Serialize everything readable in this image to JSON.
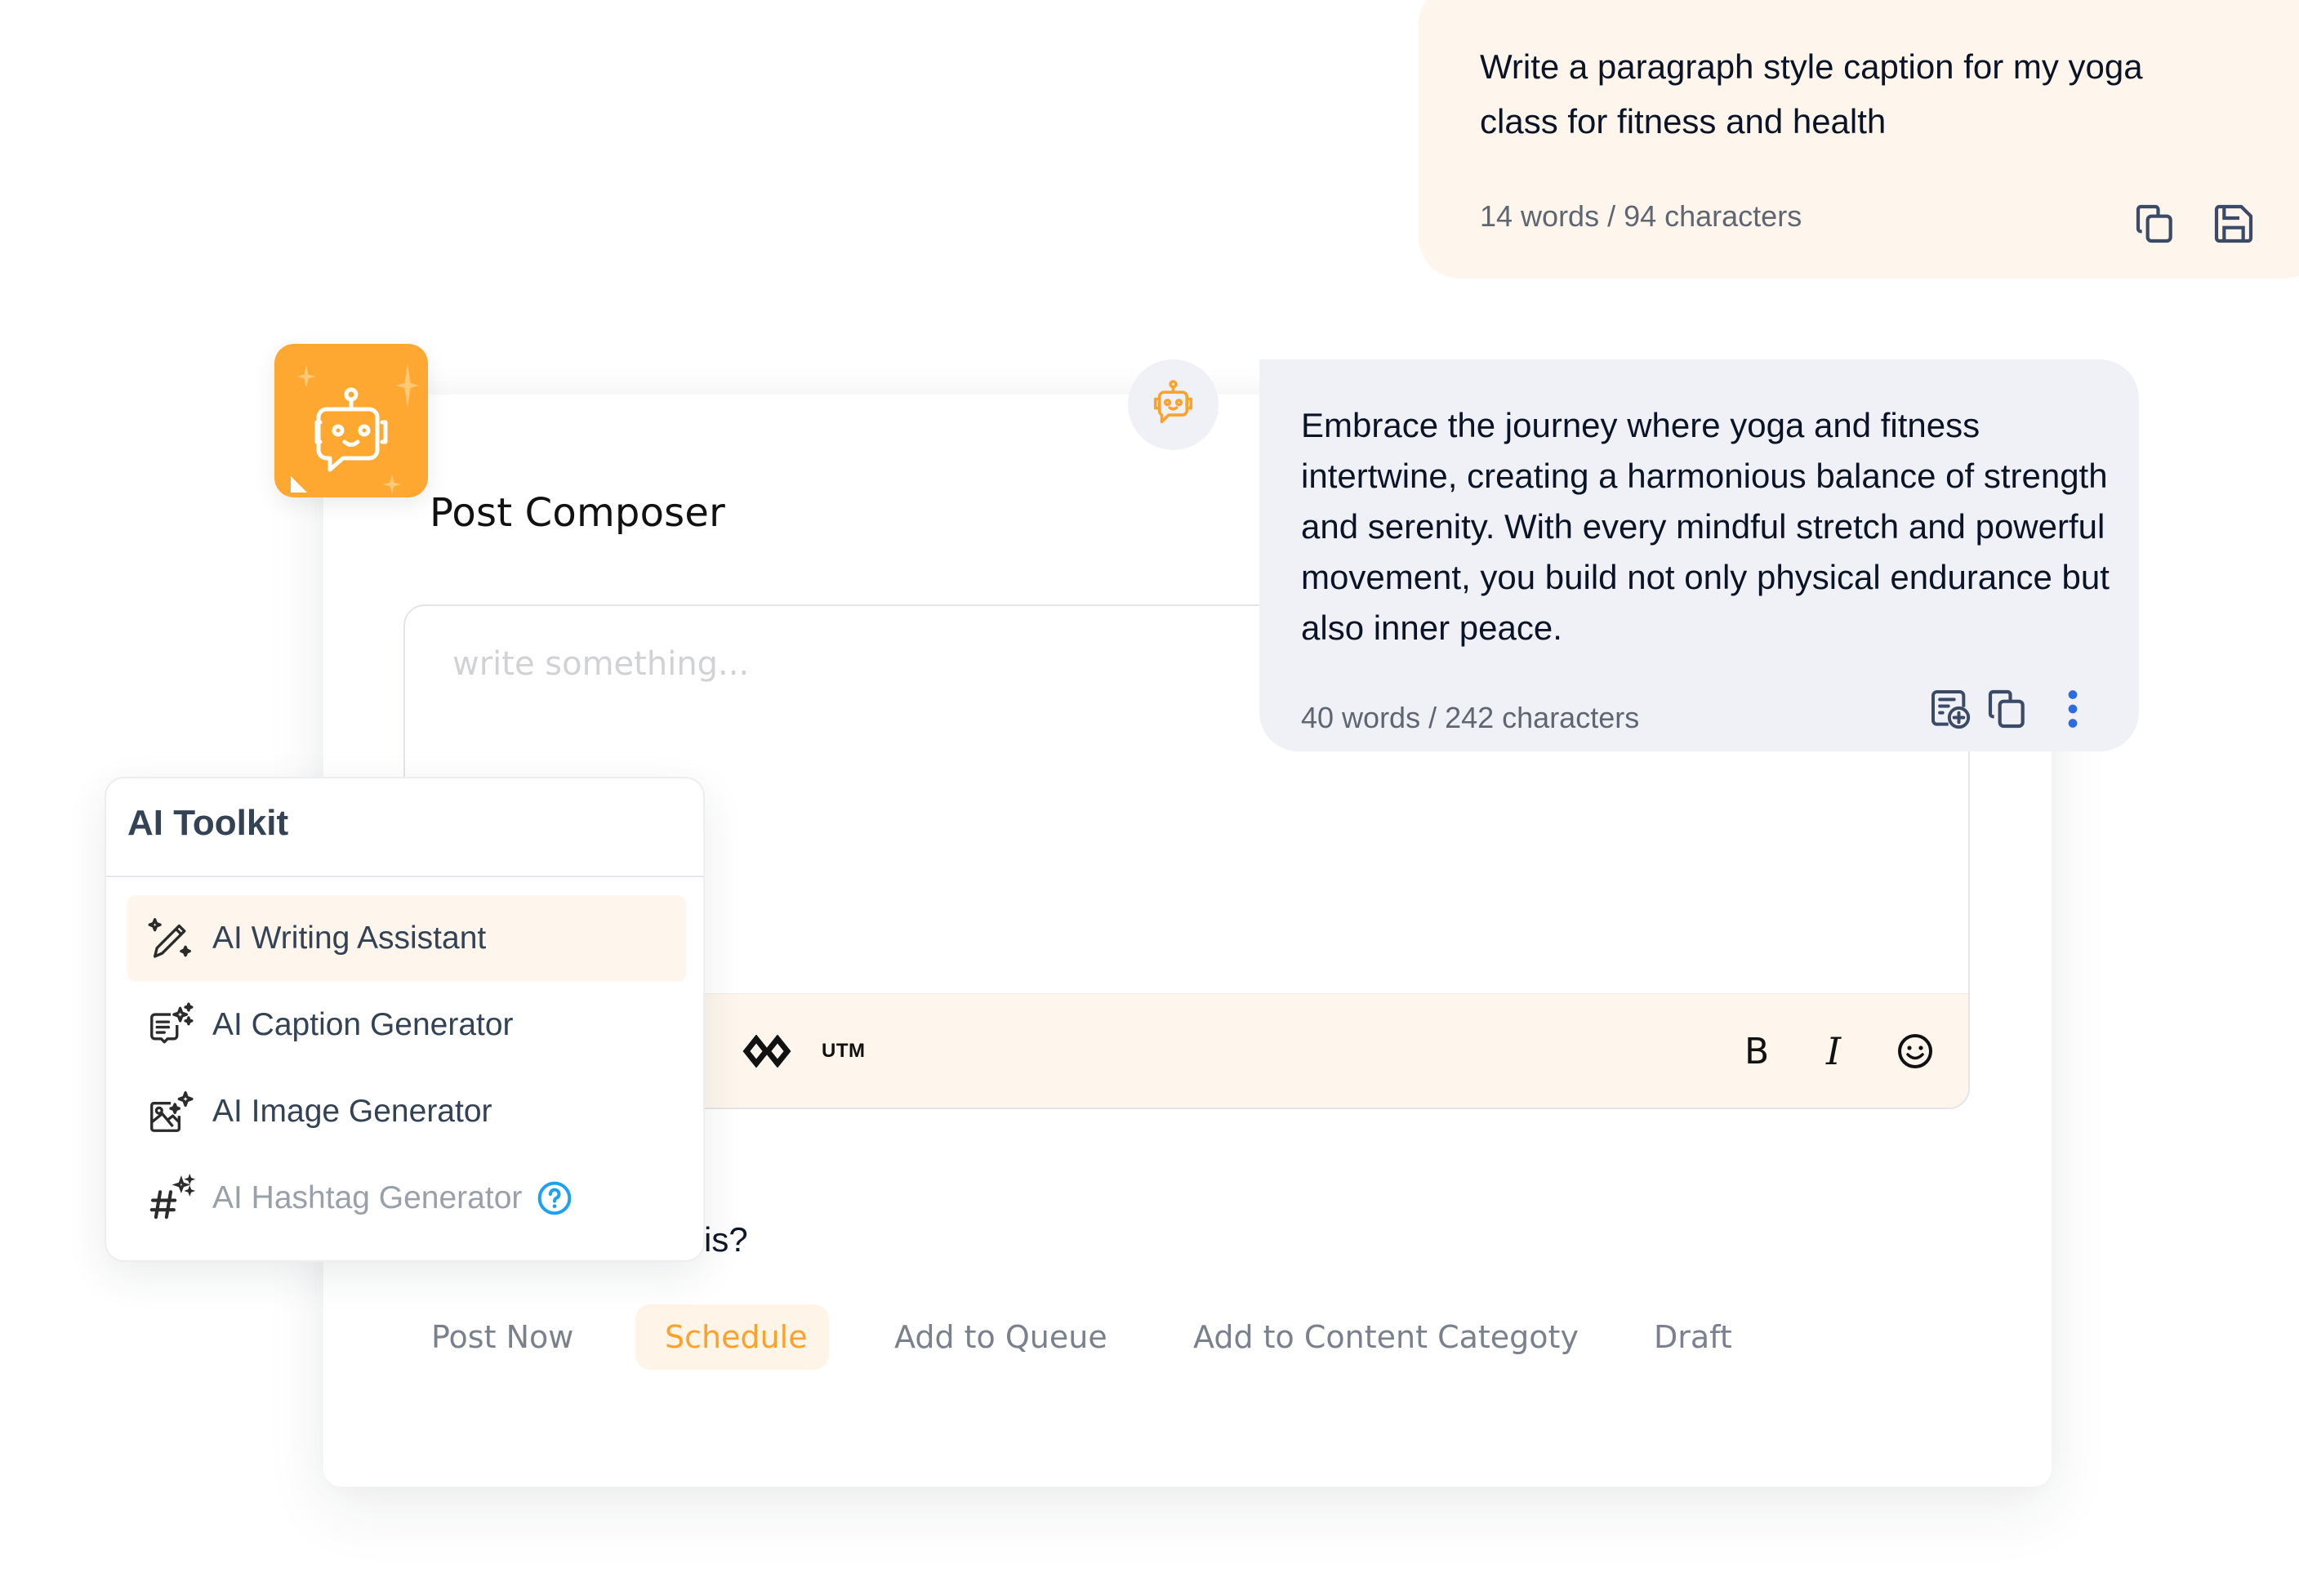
{
  "composer": {
    "title": "Post Composer",
    "editor_placeholder": "write something...",
    "toolbar": {
      "utm_label": "UTM",
      "bold_label": "B",
      "italic_label": "I"
    },
    "question_fragment": "is?",
    "actions": [
      {
        "label": "Post Now",
        "active": false
      },
      {
        "label": "Schedule",
        "active": true
      },
      {
        "label": "Add to Queue",
        "active": false
      },
      {
        "label": "Add to Content Categoty",
        "active": false
      },
      {
        "label": "Draft",
        "active": false
      }
    ]
  },
  "user_prompt": {
    "text": "Write a paragraph style caption for my yoga class for fitness and health",
    "count": "14 words / 94 characters",
    "icons": [
      "copy-icon",
      "save-icon"
    ]
  },
  "ai_reply": {
    "text": "Embrace the journey where yoga and fitness intertwine, creating a harmonious balance of strength and serenity. With every mindful stretch and powerful movement, you build not only physical endurance but also inner peace.",
    "count": "40 words / 242 characters",
    "icons": [
      "add-to-template-icon",
      "copy-icon",
      "more-options-icon"
    ]
  },
  "toolkit": {
    "title": "AI Toolkit",
    "items": [
      {
        "label": "AI Writing Assistant",
        "icon": "ai-pencil-icon",
        "active": true
      },
      {
        "label": "AI Caption Generator",
        "icon": "ai-caption-icon",
        "active": false
      },
      {
        "label": "AI Image Generator",
        "icon": "ai-image-icon",
        "active": false
      },
      {
        "label": "AI Hashtag Generator",
        "icon": "ai-hashtag-icon",
        "active": false,
        "disabled": true
      }
    ]
  },
  "colors": {
    "brand_orange": "#fea832",
    "accent_orange_text": "#fba22d",
    "highlight_bg": "#fef6ec",
    "ai_bubble_bg": "#f0f1f7",
    "link_blue": "#2d6be0",
    "help_blue": "#1da1f2"
  }
}
